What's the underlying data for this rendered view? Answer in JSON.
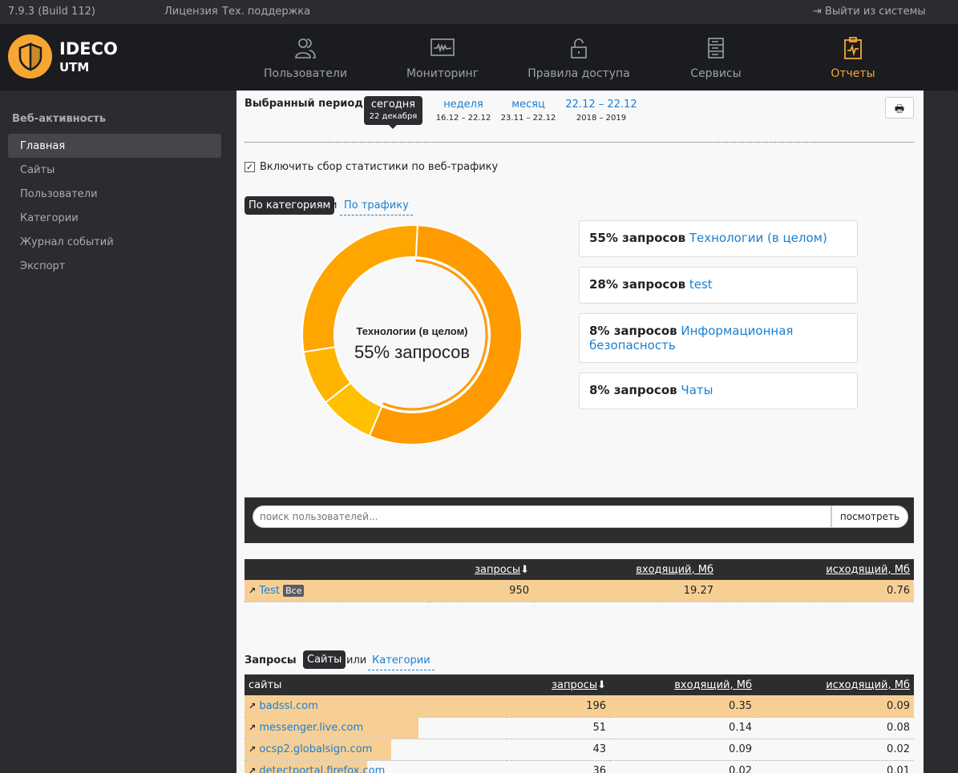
{
  "topbar": {
    "version": "7.9.3 (Build 112)",
    "license": "Лицензия",
    "support": "Тех. поддержка",
    "logout": "Выйти из системы"
  },
  "brand": {
    "name": "IDECO",
    "product": "UTM"
  },
  "nav": [
    {
      "label": "Пользователи",
      "icon": "users-icon"
    },
    {
      "label": "Мониторинг",
      "icon": "monitor-icon"
    },
    {
      "label": "Правила доступа",
      "icon": "lock-icon"
    },
    {
      "label": "Сервисы",
      "icon": "server-icon"
    },
    {
      "label": "Отчеты",
      "icon": "report-icon",
      "active": true
    }
  ],
  "sidebar": {
    "title": "Веб-активность",
    "items": [
      {
        "label": "Главная",
        "active": true
      },
      {
        "label": "Сайты"
      },
      {
        "label": "Пользователи"
      },
      {
        "label": "Категории"
      },
      {
        "label": "Журнал событий"
      },
      {
        "label": "Экспорт"
      }
    ]
  },
  "period": {
    "label": "Выбранный период:",
    "options": [
      {
        "name": "сегодня",
        "range": "22 декабря",
        "active": true
      },
      {
        "name": "неделя",
        "range": "16.12 – 22.12"
      },
      {
        "name": "месяц",
        "range": "23.11 – 22.12"
      },
      {
        "name": "22.12 – 22.12",
        "range": "2018 – 2019"
      }
    ]
  },
  "stats_checkbox": {
    "label": "Включить сбор статистики по веб-трафику",
    "checked": true
  },
  "chart_toggle": {
    "active": "По категориям",
    "sep": "и",
    "other": "По трафику"
  },
  "chart_data": {
    "type": "pie",
    "donut": true,
    "center_title": "Технологии (в целом)",
    "center_value": "55% запросов",
    "slices": [
      {
        "label": "Технологии (в целом)",
        "value": 55,
        "color": "#ff9a00"
      },
      {
        "label": "Чаты",
        "value": 8,
        "color": "#ffc000"
      },
      {
        "label": "Информационная безопасность",
        "value": 8,
        "color": "#ffb400"
      },
      {
        "label": "test",
        "value": 28,
        "color": "#ffa500"
      }
    ]
  },
  "legend": [
    {
      "pct": "55% запросов",
      "name": "Технологии (в целом)"
    },
    {
      "pct": "28% запросов",
      "name": "test"
    },
    {
      "pct": "8% запросов",
      "name": "Информационная безопасность"
    },
    {
      "pct": "8% запросов",
      "name": "Чаты"
    }
  ],
  "search": {
    "placeholder": "поиск пользователей...",
    "button": "посмотреть"
  },
  "users_table": {
    "headers": [
      "",
      "запросы",
      "входящий, Мб",
      "исходящий, Мб"
    ],
    "rows": [
      {
        "name": "Test",
        "badge": "Все",
        "requests": "950",
        "in": "19.27",
        "out": "0.76"
      }
    ]
  },
  "requests": {
    "label": "Запросы",
    "active": "Сайты",
    "sep": "или",
    "other": "Категории"
  },
  "sites_table": {
    "headers": [
      "сайты",
      "запросы",
      "входящий, Мб",
      "исходящий, Мб"
    ],
    "rows": [
      {
        "name": "badssl.com",
        "requests": 196,
        "in": "0.35",
        "out": "0.09"
      },
      {
        "name": "messenger.live.com",
        "requests": 51,
        "in": "0.14",
        "out": "0.08"
      },
      {
        "name": "ocsp2.globalsign.com",
        "requests": 43,
        "in": "0.09",
        "out": "0.02"
      },
      {
        "name": "detectportal.firefox.com",
        "requests": 36,
        "in": "0.02",
        "out": "0.01"
      }
    ]
  }
}
